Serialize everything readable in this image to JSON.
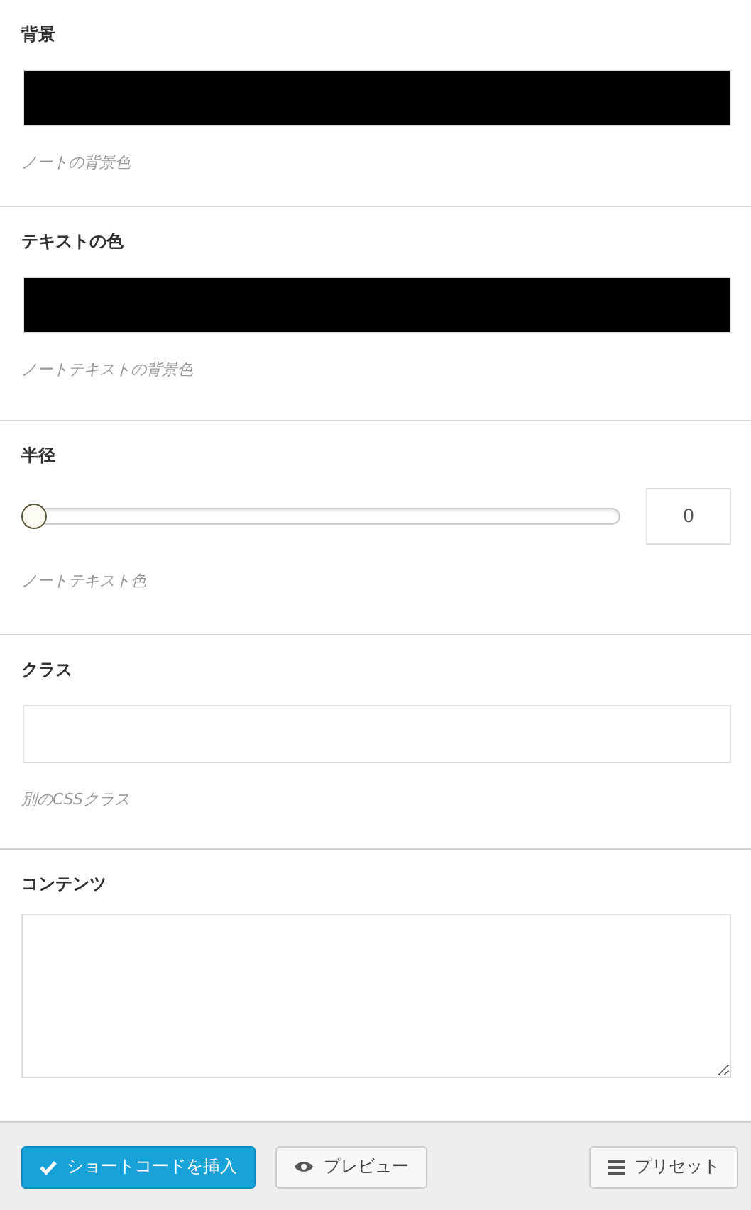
{
  "fields": [
    {
      "kind": "color",
      "label": "背景",
      "color": "#000000",
      "help": "ノートの背景色"
    },
    {
      "kind": "color",
      "label": "テキストの色",
      "color": "#000000",
      "help": "ノートテキストの背景色"
    },
    {
      "kind": "slider",
      "label": "半径",
      "level": 0,
      "value": "0",
      "help": "ノートテキスト色"
    },
    {
      "kind": "text",
      "label": "クラス",
      "help": "別のCSSクラス"
    },
    {
      "kind": "textarea",
      "label": "コンテンツ"
    }
  ],
  "footer": {
    "insert_button": "ショートコードを挿入",
    "preview_button": "プレビュー",
    "presets_button": "プリセット"
  }
}
